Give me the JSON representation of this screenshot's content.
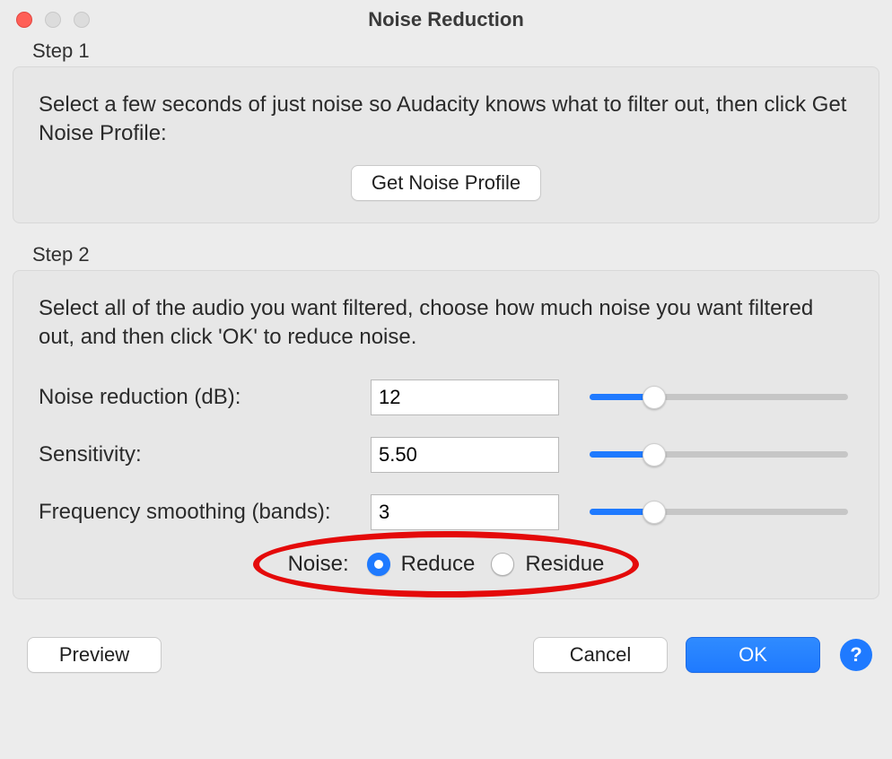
{
  "window": {
    "title": "Noise Reduction"
  },
  "step1": {
    "label": "Step 1",
    "instructions": "Select a few seconds of just noise so Audacity knows what to filter out, then click Get Noise Profile:",
    "button": "Get Noise Profile"
  },
  "step2": {
    "label": "Step 2",
    "instructions": "Select all of the audio you want filtered, choose how much noise you want filtered out, and then click 'OK' to reduce noise.",
    "params": {
      "noise_reduction": {
        "label": "Noise reduction (dB):",
        "value": "12",
        "percent": 25
      },
      "sensitivity": {
        "label": "Sensitivity:",
        "value": "5.50",
        "percent": 25
      },
      "freq_smoothing": {
        "label": "Frequency smoothing (bands):",
        "value": "3",
        "percent": 25
      }
    },
    "noise_mode": {
      "label": "Noise:",
      "reduce": "Reduce",
      "residue": "Residue",
      "selected": "reduce"
    }
  },
  "footer": {
    "preview": "Preview",
    "cancel": "Cancel",
    "ok": "OK",
    "help": "?"
  }
}
